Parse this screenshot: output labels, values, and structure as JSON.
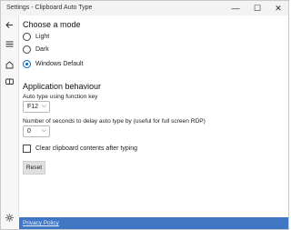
{
  "window": {
    "title": "Settings - Clipboard Auto Type"
  },
  "titlebar": {
    "minimize": "—",
    "maximize": "☐",
    "close": "✕"
  },
  "sidebar": {
    "icons": [
      "back-arrow-icon",
      "hamburger-menu-icon",
      "home-icon",
      "keyboard-icon",
      "settings-gear-icon"
    ]
  },
  "mode": {
    "heading": "Choose a mode",
    "options": [
      "Light",
      "Dark",
      "Windows Default"
    ],
    "selected": "Windows Default"
  },
  "behaviour": {
    "heading": "Application behaviour",
    "function_key_label": "Auto type using function key",
    "function_key_value": "F12",
    "delay_label": "Number of seconds to delay auto type by (useful for full screen RDP)",
    "delay_value": "0",
    "clear_label": "Clear clipboard contents after typing",
    "clear_checked": false,
    "reset_label": "Reset"
  },
  "footer": {
    "privacy_link": "Privacy Policy",
    "accent_color": "#3f77c4"
  }
}
